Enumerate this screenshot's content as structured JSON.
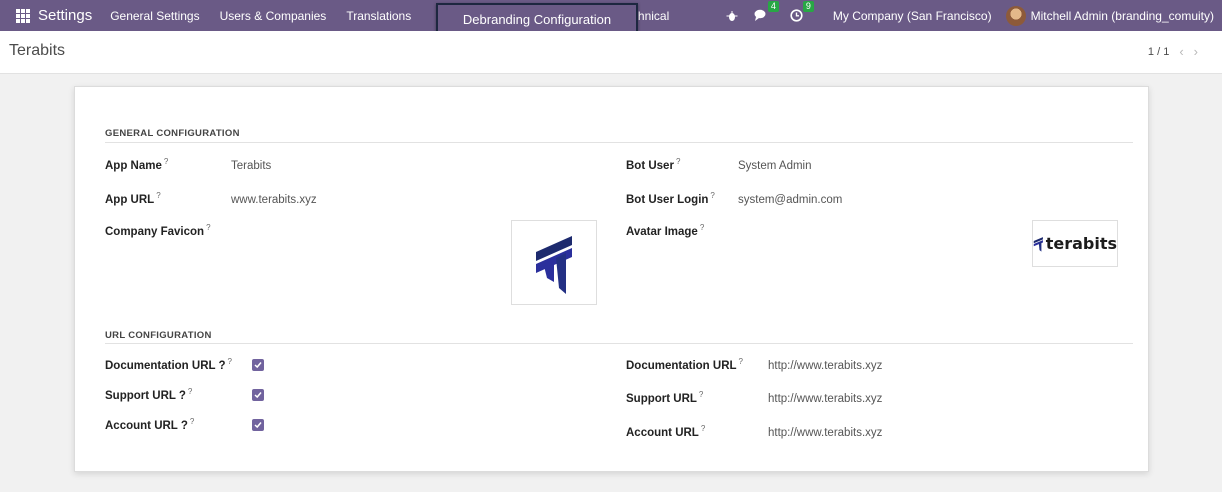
{
  "navbar": {
    "brand": "Settings",
    "menu": [
      "General Settings",
      "Users & Companies",
      "Translations",
      "Technical"
    ],
    "chat_badge": "4",
    "activity_badge": "9",
    "company": "My Company (San Francisco)",
    "user": "Mitchell Admin (branding_comuity)"
  },
  "popup": {
    "label": "Debranding Configuration"
  },
  "control_panel": {
    "breadcrumb": "Terabits",
    "pager": "1 / 1"
  },
  "general": {
    "title": "GENERAL CONFIGURATION",
    "help_mark": "?",
    "app_name_label": "App Name",
    "app_name_value": "Terabits",
    "app_url_label": "App URL",
    "app_url_value": "www.terabits.xyz",
    "favicon_label": "Company Favicon",
    "bot_user_label": "Bot User",
    "bot_user_value": "System Admin",
    "bot_login_label": "Bot User Login",
    "bot_login_value": "system@admin.com",
    "avatar_label": "Avatar Image",
    "avatar_logo_text": "terabits"
  },
  "url": {
    "title": "URL CONFIGURATION",
    "doc_check_label": "Documentation URL ?",
    "support_check_label": "Support URL ?",
    "account_check_label": "Account URL ?",
    "doc_label": "Documentation URL",
    "doc_value": "http://www.terabits.xyz",
    "support_label": "Support URL",
    "support_value": "http://www.terabits.xyz",
    "account_label": "Account URL",
    "account_value": "http://www.terabits.xyz"
  },
  "colors": {
    "navbar": "#6a5a86",
    "checkbox": "#71639e",
    "badge": "#28a745",
    "logo_blue": "#2a2f9c"
  },
  "icons": [
    "apps-grid-icon",
    "bug-icon",
    "chat-icon",
    "clock-icon",
    "check-icon",
    "terabits-logo-icon"
  ]
}
